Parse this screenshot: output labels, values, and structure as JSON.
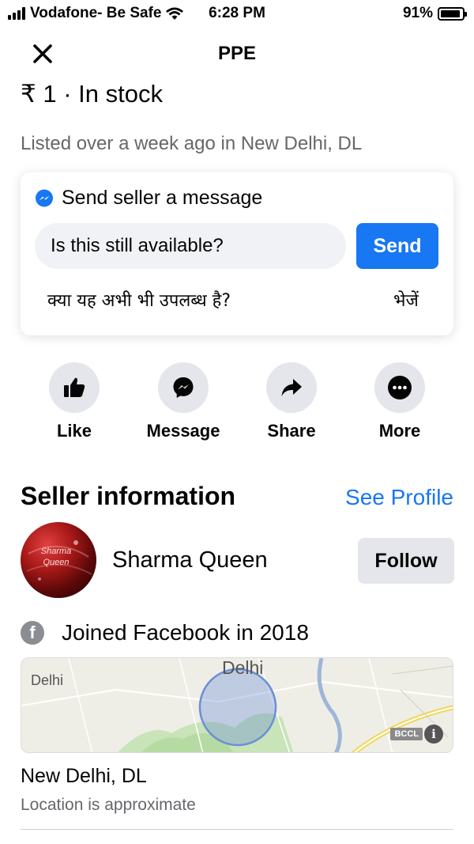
{
  "status_bar": {
    "carrier": "Vodafone- Be Safe",
    "time": "6:28 PM",
    "battery_text": "91%",
    "battery_level": 0.91,
    "icons": [
      "signal-icon",
      "wifi-icon",
      "battery-icon"
    ]
  },
  "header": {
    "title": "PPE",
    "close_icon": "close-icon"
  },
  "listing": {
    "price_line": "₹ 1 · In stock",
    "listed_text": "Listed over a week ago in New Delhi, DL"
  },
  "message_card": {
    "heading": "Send seller a message",
    "icon": "messenger-icon",
    "input_value": "Is this still available?",
    "send_label": "Send",
    "hindi_question": "क्या यह अभी भी उपलब्ध है?",
    "hindi_send": "भेजें"
  },
  "actions": [
    {
      "label": "Like",
      "icon": "thumbs-up-icon"
    },
    {
      "label": "Message",
      "icon": "messenger-icon"
    },
    {
      "label": "Share",
      "icon": "share-arrow-icon"
    },
    {
      "label": "More",
      "icon": "more-dots-icon"
    }
  ],
  "seller": {
    "section_title": "Seller information",
    "see_profile_label": "See Profile",
    "name": "Sharma Queen",
    "avatar_text": "Sharma Queen",
    "follow_label": "Follow",
    "joined_text": "Joined Facebook in 2018"
  },
  "map": {
    "label_left": "Delhi",
    "label_top": "Delhi",
    "attribution": "BCCL",
    "info_label": "i"
  },
  "location": {
    "name": "New Delhi, DL",
    "note": "Location is approximate"
  },
  "colors": {
    "accent": "#1877f2",
    "secondary_text": "#65676b",
    "button_gray": "#e4e6eb"
  }
}
